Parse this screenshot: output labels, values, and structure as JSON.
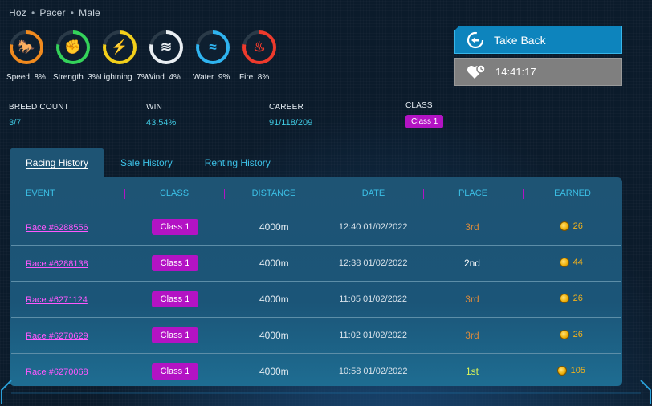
{
  "breadcrumb": [
    "Hoz",
    "Pacer",
    "Male"
  ],
  "stats": [
    {
      "label": "Speed",
      "value": "8%",
      "color": "#f08a1e",
      "icon": "horse-icon",
      "glyph": "🐎"
    },
    {
      "label": "Strength",
      "value": "3%",
      "color": "#34d25a",
      "icon": "fist-icon",
      "glyph": "✊"
    },
    {
      "label": "Lightning",
      "value": "7%",
      "color": "#f2cf1a",
      "icon": "lightning-icon",
      "glyph": "⚡"
    },
    {
      "label": "Wind",
      "value": "4%",
      "color": "#e9eef2",
      "icon": "wind-icon",
      "glyph": "≋"
    },
    {
      "label": "Water",
      "value": "9%",
      "color": "#2fb4f0",
      "icon": "water-icon",
      "glyph": "≈"
    },
    {
      "label": "Fire",
      "value": "8%",
      "color": "#ee3a2c",
      "icon": "fire-icon",
      "glyph": "♨"
    }
  ],
  "info": {
    "breed_count_label": "BREED COUNT",
    "breed_count": "3/7",
    "win_label": "WIN",
    "win": "43.54%",
    "career_label": "CAREER",
    "career": "91/118/209",
    "class_label": "CLASS",
    "class": "Class 1"
  },
  "actions": {
    "take_back": "Take Back",
    "timer": "14:41:17"
  },
  "tabs": [
    "Racing History",
    "Sale History",
    "Renting History"
  ],
  "table": {
    "headers": [
      "EVENT",
      "CLASS",
      "DISTANCE",
      "DATE",
      "PLACE",
      "EARNED"
    ],
    "rows": [
      {
        "event": "Race #6288556",
        "class": "Class 1",
        "distance": "4000m",
        "date": "12:40 01/02/2022",
        "place": "3rd",
        "earned": "26"
      },
      {
        "event": "Race #6288138",
        "class": "Class 1",
        "distance": "4000m",
        "date": "12:38 01/02/2022",
        "place": "2nd",
        "earned": "44"
      },
      {
        "event": "Race #6271124",
        "class": "Class 1",
        "distance": "4000m",
        "date": "11:05 01/02/2022",
        "place": "3rd",
        "earned": "26"
      },
      {
        "event": "Race #6270629",
        "class": "Class 1",
        "distance": "4000m",
        "date": "11:02 01/02/2022",
        "place": "3rd",
        "earned": "26"
      },
      {
        "event": "Race #6270068",
        "class": "Class 1",
        "distance": "4000m",
        "date": "10:58 01/02/2022",
        "place": "1st",
        "earned": "105"
      }
    ]
  },
  "place_colors": {
    "1st": "#d9f25a",
    "2nd": "#ffffff",
    "3rd": "#d98a3c"
  }
}
